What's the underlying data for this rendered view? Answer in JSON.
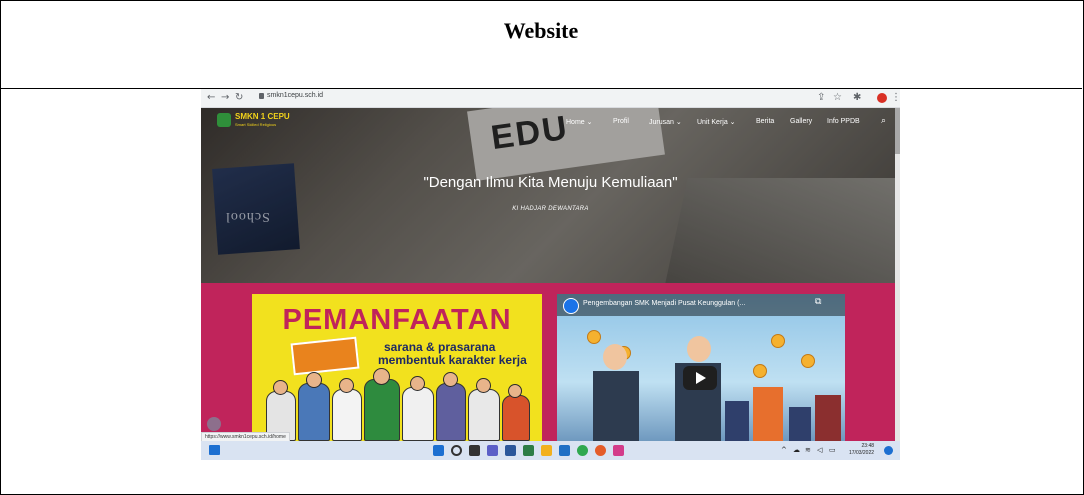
{
  "document": {
    "heading": "Website"
  },
  "browser": {
    "url": "smkn1cepu.sch.id",
    "hover_link": "https://www.smkn1cepu.sch.id/home"
  },
  "site": {
    "logo_title": "SMKN 1 CEPU",
    "logo_subtitle": "Smart Skilled Religious",
    "nav": [
      {
        "label": "Home",
        "dropdown": true
      },
      {
        "label": "Profil",
        "dropdown": false
      },
      {
        "label": "Jurusan",
        "dropdown": true
      },
      {
        "label": "Unit Kerja",
        "dropdown": true
      },
      {
        "label": "Berita",
        "dropdown": false
      },
      {
        "label": "Gallery",
        "dropdown": false
      },
      {
        "label": "Info PPDB",
        "dropdown": false
      }
    ],
    "hero_quote": "\"Dengan Ilmu Kita Menuju Kemuliaan\"",
    "hero_author": "KI HADJAR DEWANTARA",
    "hero_bg_word": "EDU",
    "hero_book_text": "School",
    "card_left": {
      "title": "PEMANFAATAN",
      "line1": "sarana & prasarana",
      "line2": "membentuk karakter kerja"
    },
    "video": {
      "title": "Pengembangan SMK Menjadi Pusat Keunggulan (..."
    }
  },
  "taskbar": {
    "time": "23:48",
    "date": "17/03/2022"
  },
  "colors": {
    "magenta": "#c0245b",
    "yellow": "#f2e11e",
    "taskbar": "#d9e3f2"
  }
}
